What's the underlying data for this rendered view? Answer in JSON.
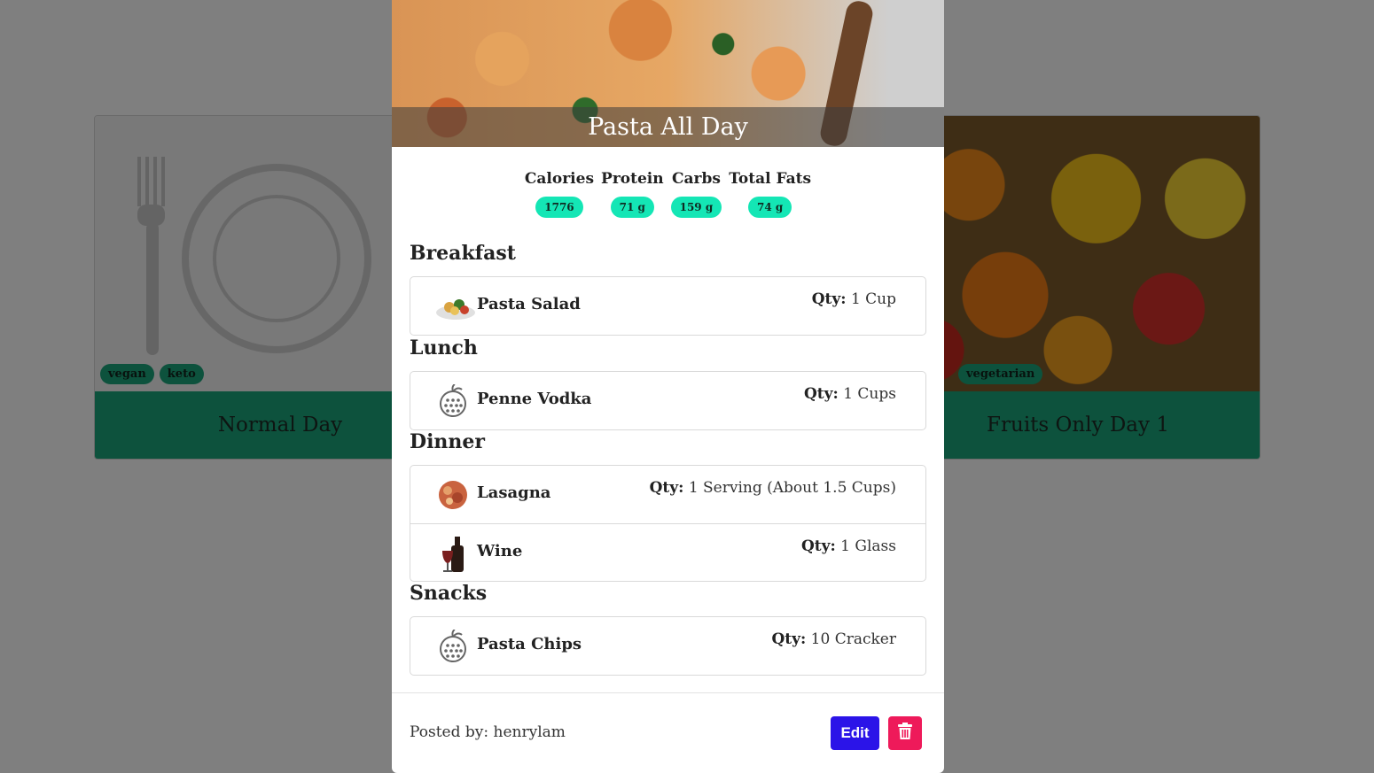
{
  "cards": [
    {
      "title": "Normal Day",
      "tags": [
        "vegan",
        "keto"
      ]
    },
    {
      "title": "Fruits Only Day 1",
      "tags": [
        "vegetarian"
      ]
    }
  ],
  "modal": {
    "title": "Pasta All Day",
    "macros": [
      {
        "label": "Calories",
        "value": "1776"
      },
      {
        "label": "Protein",
        "value": "71 g"
      },
      {
        "label": "Carbs",
        "value": "159 g"
      },
      {
        "label": "Total Fats",
        "value": "74 g"
      }
    ],
    "meals": [
      {
        "title": "Breakfast",
        "items": [
          {
            "name": "Pasta Salad",
            "qty_label": "Qty:",
            "qty": "1 Cup",
            "icon": "pasta-salad-icon"
          }
        ]
      },
      {
        "title": "Lunch",
        "items": [
          {
            "name": "Penne Vodka",
            "qty_label": "Qty:",
            "qty": "1 Cups",
            "icon": "apple-icon"
          }
        ]
      },
      {
        "title": "Dinner",
        "items": [
          {
            "name": "Lasagna",
            "qty_label": "Qty:",
            "qty": "1 Serving (About 1.5 Cups)",
            "icon": "lasagna-icon"
          },
          {
            "name": "Wine",
            "qty_label": "Qty:",
            "qty": "1 Glass",
            "icon": "wine-icon"
          }
        ]
      },
      {
        "title": "Snacks",
        "items": [
          {
            "name": "Pasta Chips",
            "qty_label": "Qty:",
            "qty": "10 Cracker",
            "icon": "apple-icon"
          }
        ]
      }
    ],
    "posted_by": "Posted by: henrylam",
    "edit_label": "Edit",
    "delete_icon": "trash-icon"
  },
  "colors": {
    "accent_green": "#1aa57a",
    "macro_badge": "#14e6b5",
    "edit": "#2b14e8",
    "delete": "#ee1a5a"
  }
}
